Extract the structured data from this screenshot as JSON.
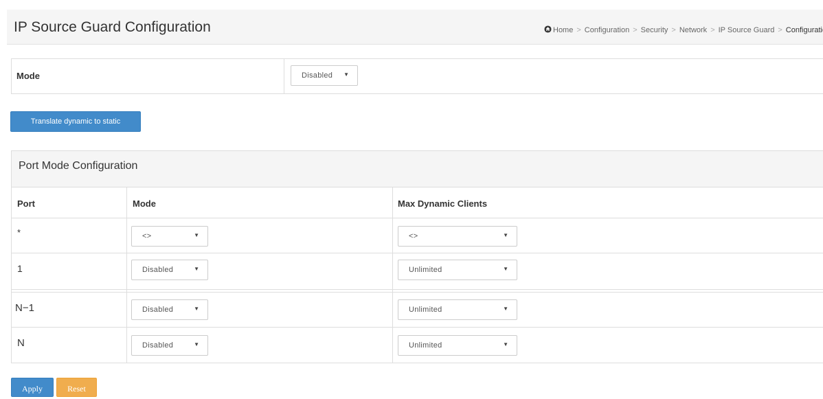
{
  "header": {
    "title": "IP Source Guard Configuration",
    "breadcrumb": [
      "Home",
      "Configuration",
      "Security",
      "Network",
      "IP Source Guard",
      "Configuration"
    ],
    "separator": ">"
  },
  "global_mode": {
    "label": "Mode",
    "value": "Disabled"
  },
  "translate_button": "Translate dynamic to static",
  "port_panel": {
    "title": "Port Mode Configuration",
    "columns": [
      "Port",
      "Mode",
      "Max Dynamic Clients"
    ],
    "rows": [
      {
        "port": "*",
        "mode": "<>",
        "max_clients": "<>"
      },
      {
        "port": "1",
        "mode": "Disabled",
        "max_clients": "Unlimited"
      },
      {
        "port": "N−1",
        "mode": "Disabled",
        "max_clients": "Unlimited"
      },
      {
        "port": "N",
        "mode": "Disabled",
        "max_clients": "Unlimited"
      }
    ]
  },
  "actions": {
    "apply": "Apply",
    "reset": "Reset"
  },
  "colors": {
    "primary": "#428bca",
    "warning": "#f0ad4e",
    "header_bg": "#f5f5f5",
    "border": "#dddddd"
  },
  "icons": {
    "home": "home-icon",
    "dropdown": "caret-down-icon"
  }
}
